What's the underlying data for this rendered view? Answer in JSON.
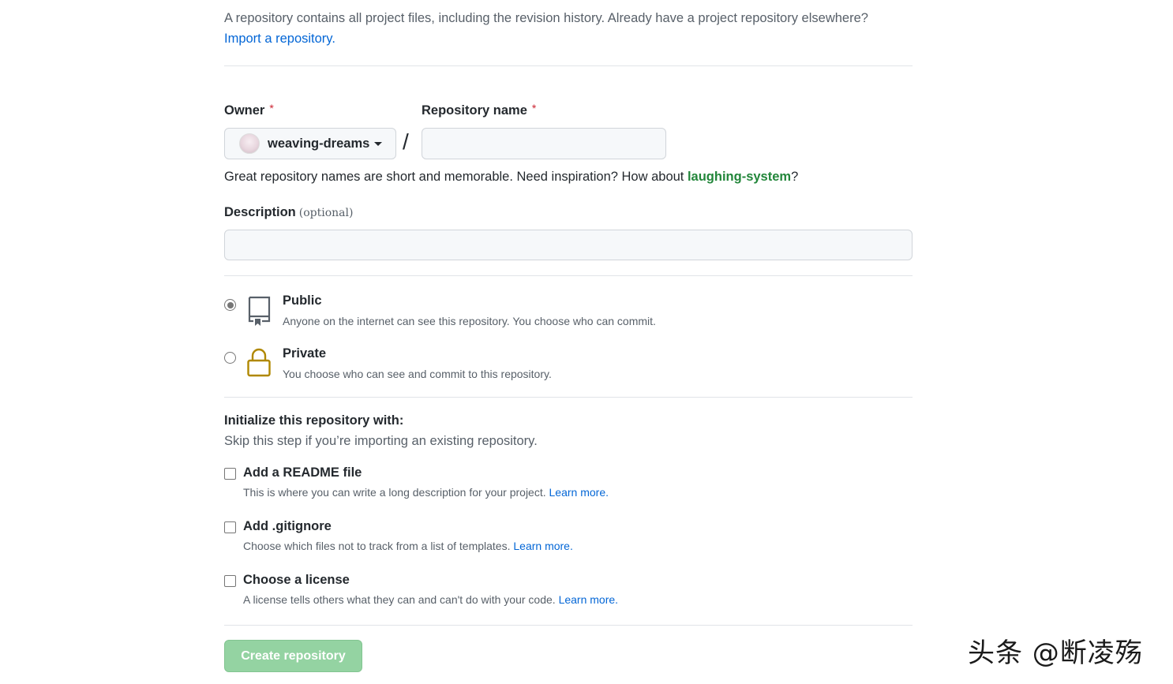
{
  "intro": {
    "text": "A repository contains all project files, including the revision history. Already have a project repository elsewhere?",
    "import_link": "Import a repository."
  },
  "owner": {
    "label": "Owner",
    "required_mark": "*",
    "selected": "weaving-dreams"
  },
  "separator": "/",
  "repo_name": {
    "label": "Repository name",
    "required_mark": "*",
    "value": ""
  },
  "name_hint": {
    "prefix": "Great repository names are short and memorable. Need inspiration? How about ",
    "suggestion": "laughing-system",
    "suffix": "?"
  },
  "description": {
    "label": "Description",
    "optional": "(optional)",
    "value": ""
  },
  "visibility": {
    "options": [
      {
        "title": "Public",
        "desc": "Anyone on the internet can see this repository. You choose who can commit.",
        "checked": true,
        "icon": "repo-icon"
      },
      {
        "title": "Private",
        "desc": "You choose who can see and commit to this repository.",
        "checked": false,
        "icon": "lock-icon"
      }
    ]
  },
  "initialize": {
    "title": "Initialize this repository with:",
    "subtitle": "Skip this step if you’re importing an existing repository.",
    "items": [
      {
        "title": "Add a README file",
        "desc": "This is where you can write a long description for your project.",
        "link": "Learn more.",
        "checked": false
      },
      {
        "title": "Add .gitignore",
        "desc": "Choose which files not to track from a list of templates.",
        "link": "Learn more.",
        "checked": false
      },
      {
        "title": "Choose a license",
        "desc": "A license tells others what they can and can't do with your code.",
        "link": "Learn more.",
        "checked": false
      }
    ]
  },
  "create_button": "Create repository",
  "watermark": "头条 @断凌殇",
  "colors": {
    "link": "#0366d6",
    "suggestion": "#22863a",
    "required": "#cb2431",
    "lock_icon": "#b08800",
    "button_disabled": "#94d3a2"
  }
}
